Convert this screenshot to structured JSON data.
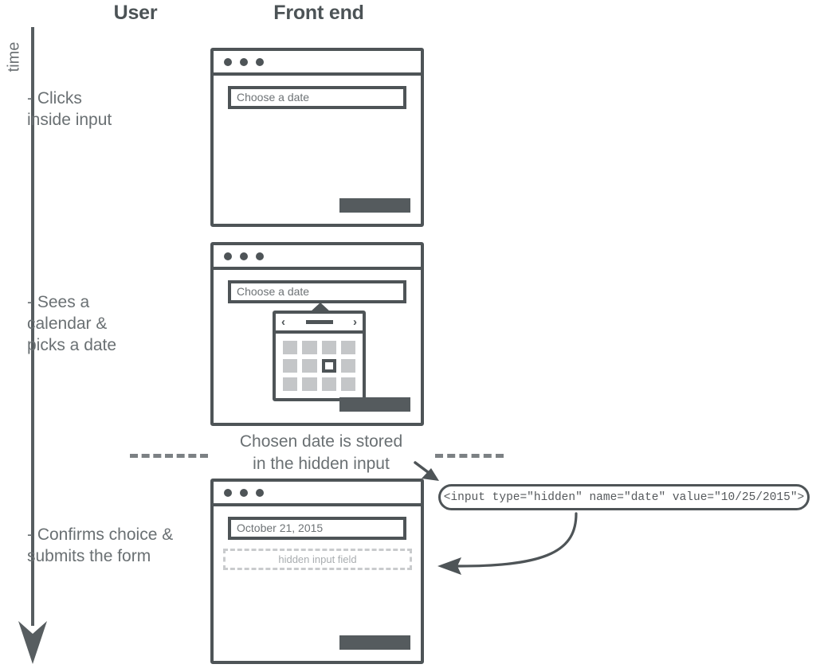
{
  "columns": {
    "user": "User",
    "frontend": "Front end"
  },
  "time_axis": {
    "label": "time",
    "arrow_direction": "down",
    "icon": "down-arrow-icon"
  },
  "steps": [
    {
      "id": "step-1",
      "note": "- Clicks\n   inside input",
      "window": {
        "title_bar_dots": 3,
        "input_value": "Choose a date",
        "submit_button_label": "",
        "has_calendar": false,
        "has_hidden_field": false
      }
    },
    {
      "id": "step-2",
      "note": "- Sees a\n   calendar &\n   picks a date",
      "window": {
        "title_bar_dots": 3,
        "input_value": "Choose a date",
        "submit_button_label": "",
        "has_calendar": true,
        "has_hidden_field": false
      },
      "calendar": {
        "prev_label": "‹",
        "next_label": "›",
        "month_label": "",
        "rows": 3,
        "cols": 4,
        "selected_index": 6
      }
    },
    {
      "id": "step-3",
      "note": "- Confirms choice &\n   submits the form",
      "window": {
        "title_bar_dots": 3,
        "input_value": "October 21, 2015",
        "submit_button_label": "",
        "has_calendar": false,
        "has_hidden_field": true,
        "hidden_field_label": "hidden input field"
      }
    }
  ],
  "separator": {
    "caption": "Chosen date is stored\nin the hidden input",
    "style": "dashed"
  },
  "code_box": {
    "code": "<input type=\"hidden\" name=\"date\" value=\"10/25/2015\">"
  },
  "arrows": {
    "to_code_box": "arrow-down-right-icon",
    "to_hidden_field": "curved-arrow-left-icon"
  },
  "colors": {
    "ink": "#4e5457",
    "text": "#6a7073",
    "muted": "#a9adb0",
    "cell": "#c4c6c8",
    "dashed": "#7c8184",
    "background": "#ffffff"
  }
}
